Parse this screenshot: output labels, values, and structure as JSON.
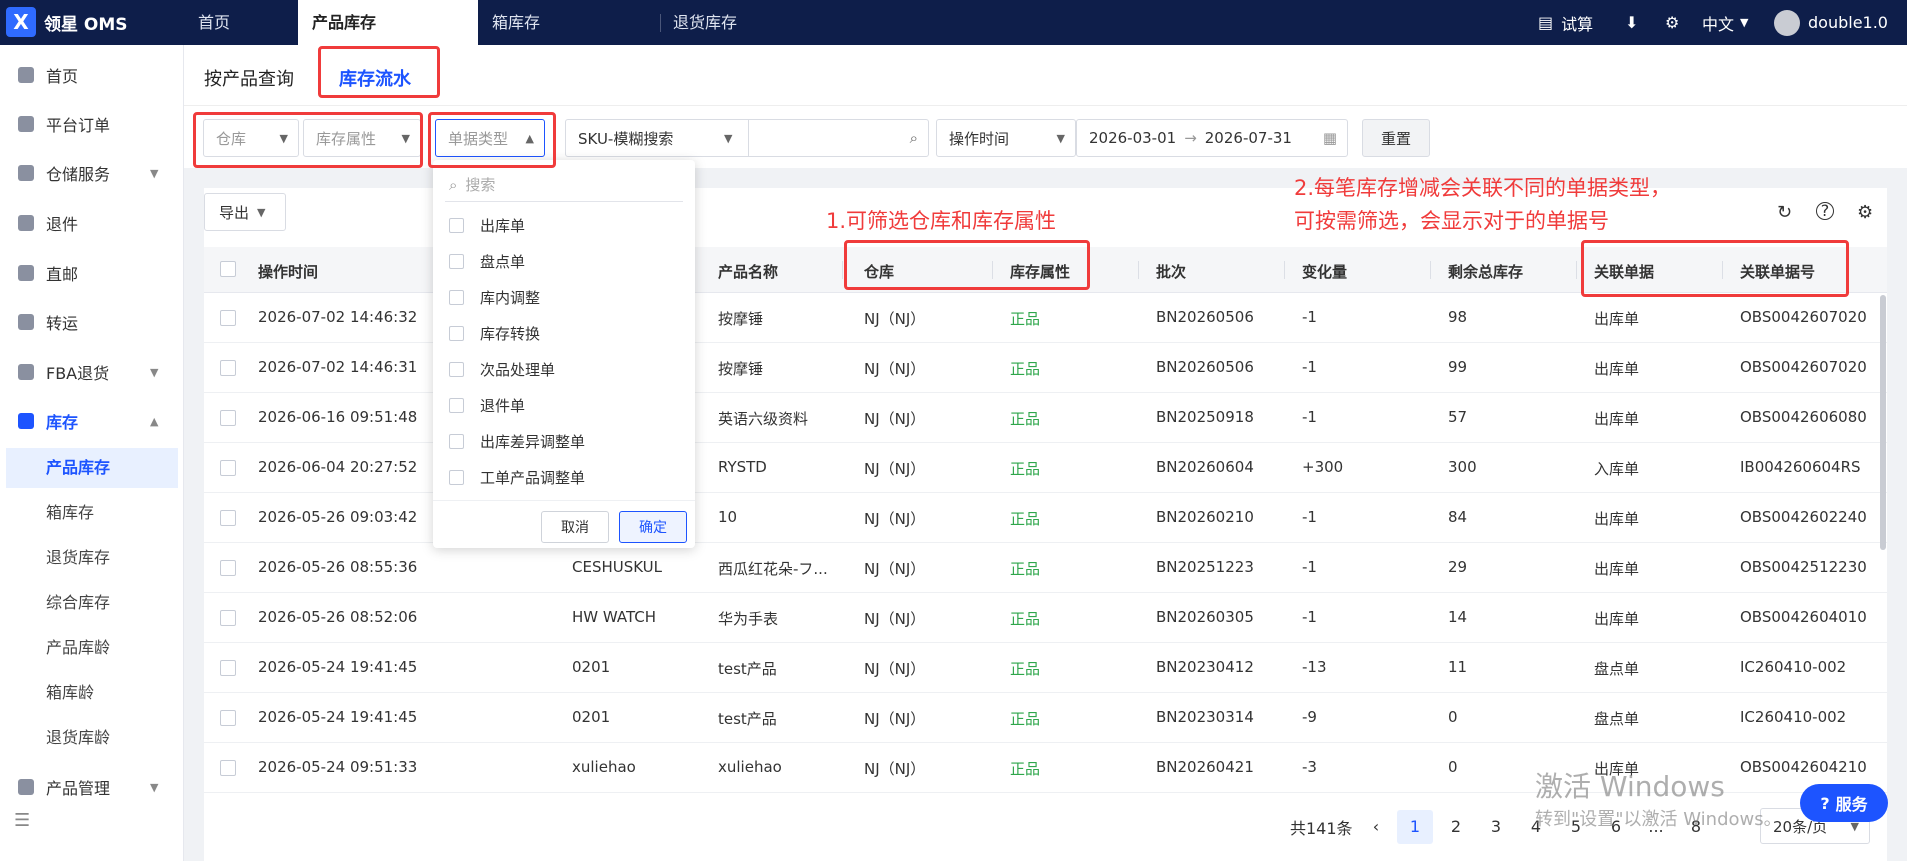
{
  "app": {
    "logo_letter": "X",
    "name": "领星 OMS"
  },
  "top_tabs": [
    {
      "label": "首页"
    },
    {
      "label": "产品库存"
    },
    {
      "label": "箱库存"
    },
    {
      "label": "退货库存"
    }
  ],
  "top_right": {
    "trial": "试算",
    "lang": "中文",
    "user": "double1.0"
  },
  "sidebar": {
    "items": [
      {
        "label": "首页"
      },
      {
        "label": "平台订单"
      },
      {
        "label": "仓储服务"
      },
      {
        "label": "退件"
      },
      {
        "label": "直邮"
      },
      {
        "label": "转运"
      },
      {
        "label": "FBA退货"
      },
      {
        "label": "库存"
      }
    ],
    "sub_items": [
      {
        "label": "产品库存"
      },
      {
        "label": "箱库存"
      },
      {
        "label": "退货库存"
      },
      {
        "label": "综合库存"
      },
      {
        "label": "产品库龄"
      },
      {
        "label": "箱库龄"
      },
      {
        "label": "退货库龄"
      }
    ],
    "last_item": {
      "label": "产品管理"
    },
    "collapse_icon": "☰"
  },
  "subtabs": [
    {
      "label": "按产品查询"
    },
    {
      "label": "库存流水"
    }
  ],
  "filters": {
    "warehouse_placeholder": "仓库",
    "attr_placeholder": "库存属性",
    "doc_type_placeholder": "单据类型",
    "sku_select": "SKU-模糊搜索",
    "time_select": "操作时间",
    "date_start": "2026-03-01",
    "date_end": "2026-07-31",
    "reset_label": "重置"
  },
  "toolbar": {
    "export_label": "导出"
  },
  "table": {
    "headers": {
      "time": "操作时间",
      "product_name": "产品名称",
      "warehouse": "仓库",
      "attr": "库存属性",
      "batch": "批次",
      "change": "变化量",
      "remaining": "剩余总库存",
      "doc": "关联单据",
      "doc_no": "关联单据号"
    },
    "rows": [
      {
        "time": "2026-07-02 14:46:32",
        "sku": "",
        "name": "按摩锤",
        "wh": "NJ（NJ）",
        "attr": "正品",
        "batch": "BN20260506",
        "change": "-1",
        "remain": "98",
        "doc": "出库单",
        "doc_no": "OBS0042607020..."
      },
      {
        "time": "2026-07-02 14:46:31",
        "sku": "",
        "name": "按摩锤",
        "wh": "NJ（NJ）",
        "attr": "正品",
        "batch": "BN20260506",
        "change": "-1",
        "remain": "99",
        "doc": "出库单",
        "doc_no": "OBS0042607020..."
      },
      {
        "time": "2026-06-16 09:51:48",
        "sku": "",
        "name": "英语六级资料",
        "wh": "NJ（NJ）",
        "attr": "正品",
        "batch": "BN20250918",
        "change": "-1",
        "remain": "57",
        "doc": "出库单",
        "doc_no": "OBS0042606080..."
      },
      {
        "time": "2026-06-04 20:27:52",
        "sku": "",
        "name": "RYSTD",
        "wh": "NJ（NJ）",
        "attr": "正品",
        "batch": "BN20260604",
        "change": "+300",
        "remain": "300",
        "doc": "入库单",
        "doc_no": "IB004260604RS"
      },
      {
        "time": "2026-05-26 09:03:42",
        "sku": "",
        "name": "10",
        "wh": "NJ（NJ）",
        "attr": "正品",
        "batch": "BN20260210",
        "change": "-1",
        "remain": "84",
        "doc": "出库单",
        "doc_no": "OBS0042602240..."
      },
      {
        "time": "2026-05-26 08:55:36",
        "sku": "CESHUSKUL",
        "name": "西瓜红花朵-フ...",
        "wh": "NJ（NJ）",
        "attr": "正品",
        "batch": "BN20251223",
        "change": "-1",
        "remain": "29",
        "doc": "出库单",
        "doc_no": "OBS0042512230..."
      },
      {
        "time": "2026-05-26 08:52:06",
        "sku": "HW WATCH",
        "name": "华为手表",
        "wh": "NJ（NJ）",
        "attr": "正品",
        "batch": "BN20260305",
        "change": "-1",
        "remain": "14",
        "doc": "出库单",
        "doc_no": "OBS0042604010..."
      },
      {
        "time": "2026-05-24 19:41:45",
        "sku": "0201",
        "name": "test产品",
        "wh": "NJ（NJ）",
        "attr": "正品",
        "batch": "BN20230412",
        "change": "-13",
        "remain": "11",
        "doc": "盘点单",
        "doc_no": "IC260410-002"
      },
      {
        "time": "2026-05-24 19:41:45",
        "sku": "0201",
        "name": "test产品",
        "wh": "NJ（NJ）",
        "attr": "正品",
        "batch": "BN20230314",
        "change": "-9",
        "remain": "0",
        "doc": "盘点单",
        "doc_no": "IC260410-002"
      },
      {
        "time": "2026-05-24 09:51:33",
        "sku": "xuliehao",
        "name": "xuliehao",
        "wh": "NJ（NJ）",
        "attr": "正品",
        "batch": "BN20260421",
        "change": "-3",
        "remain": "0",
        "doc": "出库单",
        "doc_no": "OBS0042604210..."
      }
    ]
  },
  "dropdown": {
    "search_placeholder": "搜索",
    "options": [
      {
        "label": "出库单"
      },
      {
        "label": "盘点单"
      },
      {
        "label": "库内调整"
      },
      {
        "label": "库存转换"
      },
      {
        "label": "次品处理单"
      },
      {
        "label": "退件单"
      },
      {
        "label": "出库差异调整单"
      },
      {
        "label": "工单产品调整单"
      }
    ],
    "cancel_label": "取消",
    "ok_label": "确定"
  },
  "annotations": {
    "note1": "1.可筛选仓库和库存属性",
    "note2_line1": "2.每笔库存增减会关联不同的单据类型，",
    "note2_line2": "可按需筛选，会显示对于的单据号"
  },
  "pagination": {
    "total": "共141条",
    "pages": [
      "1",
      "2",
      "3",
      "4",
      "5",
      "6",
      "...",
      "8"
    ],
    "current": "1",
    "page_size": "20条/页"
  },
  "overlay": {
    "windows_line1": "激活 Windows",
    "windows_line2": "转到\"设置\"以激活 Windows。",
    "service": "服务"
  },
  "colors": {
    "brand": "#1d54ff",
    "topbar": "#0e1e4a",
    "annotation": "#f03b3b",
    "good": "#2ea64b"
  }
}
